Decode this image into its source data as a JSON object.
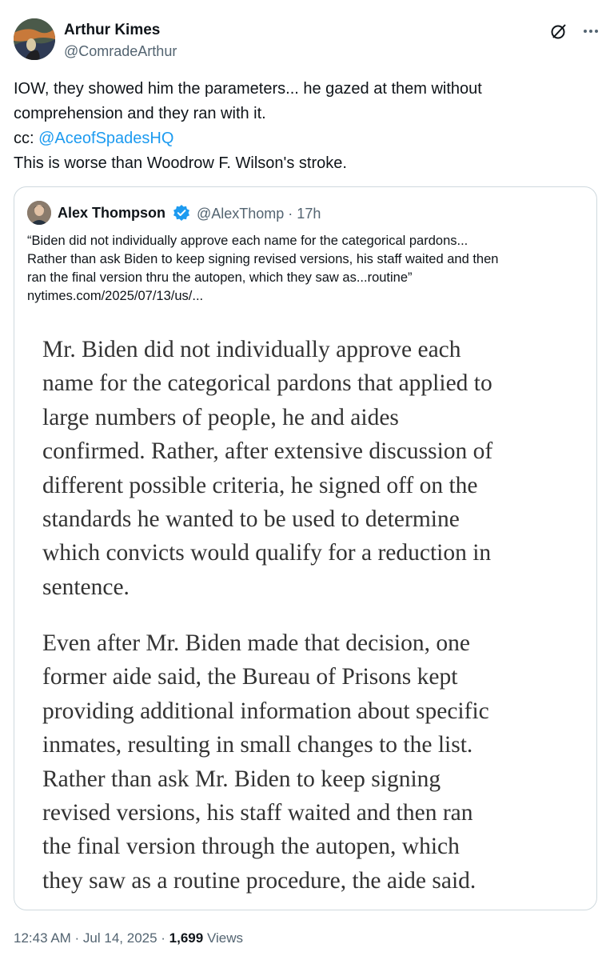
{
  "author": {
    "name": "Arthur Kimes",
    "handle": "@ComradeArthur"
  },
  "tweet": {
    "lines": [
      "IOW, they showed him the parameters... he gazed at them without",
      "comprehension and they ran with it."
    ],
    "cc_prefix": "cc: ",
    "mention": "@AceofSpadesHQ",
    "last_line": "This is worse than Woodrow F. Wilson's stroke."
  },
  "quoted": {
    "name": "Alex Thompson",
    "handle_time": "@AlexThomp · 17h",
    "text_lines": [
      "“Biden did not individually approve each name for the categorical pardons...",
      "Rather than ask Biden to keep signing revised versions, his staff waited and then",
      "ran the final version thru the autopen, which they saw as...routine”",
      "nytimes.com/2025/07/13/us/..."
    ],
    "article": {
      "paragraph1": [
        "Mr. Biden did not individually approve each",
        "name for the categorical pardons that applied to",
        "large numbers of people, he and aides",
        "confirmed. Rather, after extensive discussion of",
        "different possible criteria, he signed off on the",
        "standards he wanted to be used to determine",
        "which convicts would qualify for a reduction in",
        "sentence."
      ],
      "paragraph2": [
        "Even after Mr. Biden made that decision, one",
        "former aide said, the Bureau of Prisons kept",
        "providing additional information about specific",
        "inmates, resulting in small changes to the list.",
        "Rather than ask Mr. Biden to keep signing",
        "revised versions, his staff waited and then ran",
        "the final version through the autopen, which",
        "they saw as a routine procedure, the aide said."
      ]
    }
  },
  "footer": {
    "timestamp": "12:43 AM · Jul 14, 2025 · ",
    "views_count": "1,699",
    "views_label": " Views"
  },
  "icons": {
    "top_right": [
      "grok-icon",
      "more-options-icon"
    ],
    "verified": "verified-badge-icon"
  },
  "colors": {
    "link": "#1d9bf0",
    "secondary_text": "#536471",
    "border": "#cfd9de"
  }
}
